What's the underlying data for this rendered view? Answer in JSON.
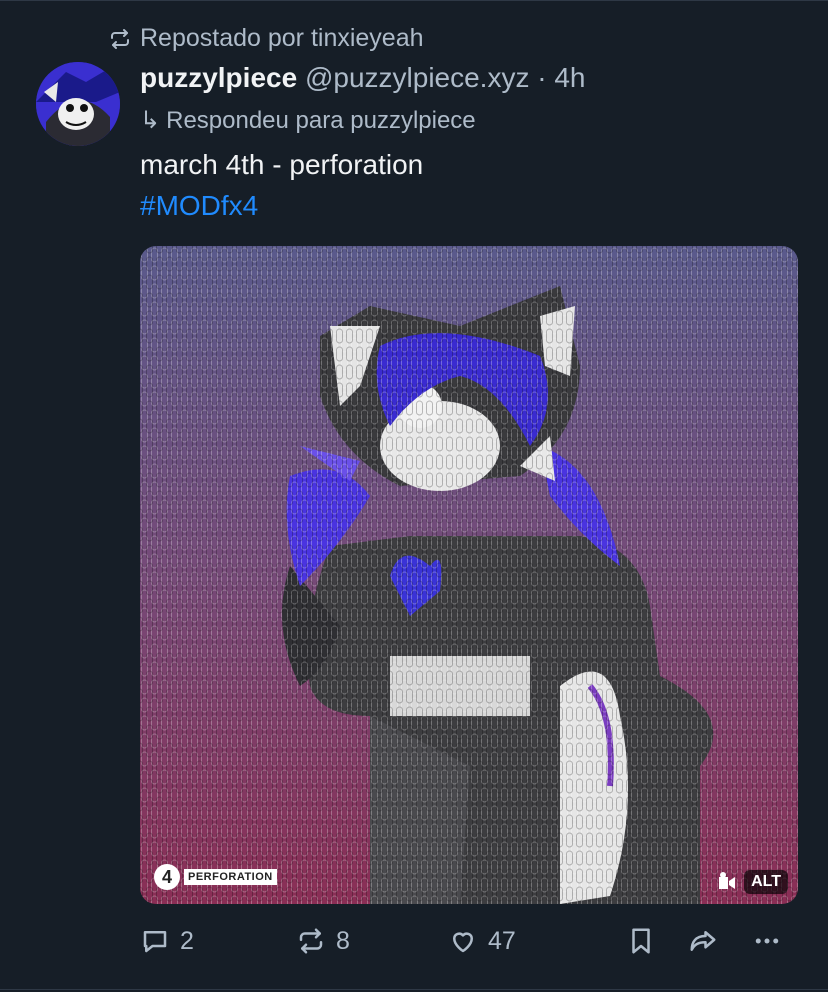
{
  "repost": {
    "text": "Repostado por tinxieyeah"
  },
  "post": {
    "display_name": "puzzylpiece",
    "handle_time": " @puzzylpiece.xyz · 4h",
    "reply_to": "Respondeu para puzzylpiece",
    "text": "march 4th - perforation",
    "hashtag": "#MODfx4"
  },
  "media": {
    "alt_label": "ALT",
    "watermark_number": "4",
    "watermark_label": "PERFORATION"
  },
  "actions": {
    "reply_count": "2",
    "repost_count": "8",
    "like_count": "47"
  },
  "icons": {
    "repost": "repost-icon",
    "reply": "reply-icon",
    "like": "heart-icon",
    "bookmark": "bookmark-icon",
    "share": "share-icon",
    "more": "more-icon"
  },
  "colors": {
    "background": "#161e27",
    "muted": "#aebbc9",
    "link": "#208bfe"
  }
}
